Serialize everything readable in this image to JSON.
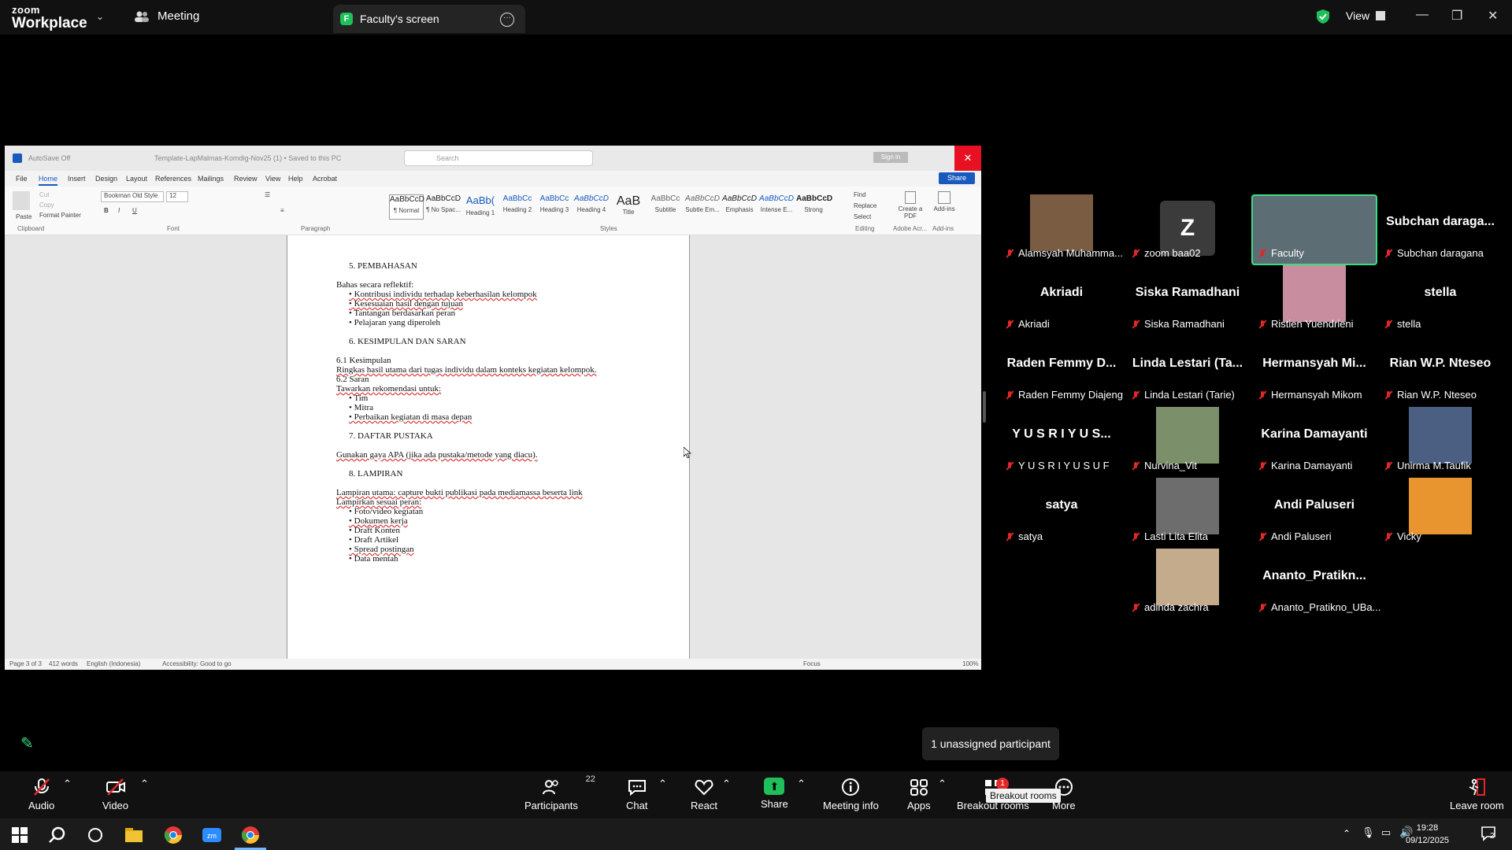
{
  "app": {
    "logo_line1": "zoom",
    "logo_line2": "Workplace"
  },
  "topbar": {
    "meeting_tab": "Meeting",
    "screen_tab": "Faculty's screen",
    "screen_badge": "F",
    "view_label": "View"
  },
  "word": {
    "autosave": "AutoSave  Off",
    "doc_title": "Template-LapMalmas-Komdig-Nov25 (1) • Saved to this PC",
    "search_placeholder": "Search",
    "sign_in": "Sign in",
    "share": "Share",
    "menu": [
      "File",
      "Home",
      "Insert",
      "Design",
      "Layout",
      "References",
      "Mailings",
      "Review",
      "View",
      "Help",
      "Acrobat"
    ],
    "clipboard": {
      "paste": "Paste",
      "cut": "Cut",
      "copy": "Copy",
      "format_painter": "Format Painter"
    },
    "font_name": "Bookman Old Style",
    "font_size": "12",
    "groups": [
      "Clipboard",
      "Font",
      "Paragraph",
      "Styles",
      "Editing",
      "Adobe Acr...",
      "Add-ins"
    ],
    "styles": [
      {
        "sample": "AaBbCcD",
        "name": "¶ Normal"
      },
      {
        "sample": "AaBbCcD",
        "name": "¶ No Spac..."
      },
      {
        "sample": "AaBb(",
        "name": "Heading 1"
      },
      {
        "sample": "AaBbCc",
        "name": "Heading 2"
      },
      {
        "sample": "AaBbCc",
        "name": "Heading 3"
      },
      {
        "sample": "AaBbCcD",
        "name": "Heading 4"
      },
      {
        "sample": "AaB",
        "name": "Title"
      },
      {
        "sample": "AaBbCc",
        "name": "Subtitle"
      },
      {
        "sample": "AaBbCcD",
        "name": "Subtle Em..."
      },
      {
        "sample": "AaBbCcD",
        "name": "Emphasis"
      },
      {
        "sample": "AaBbCcD",
        "name": "Intense E..."
      },
      {
        "sample": "AaBbCcD",
        "name": "Strong"
      }
    ],
    "editing": {
      "find": "Find",
      "replace": "Replace",
      "select": "Select"
    },
    "create_pdf": "Create a PDF",
    "addins": "Add-ins",
    "status": {
      "page": "Page 3 of 3",
      "words": "412 words",
      "language": "English (Indonesia)",
      "accessibility": "Accessibility: Good to go",
      "focus": "Focus",
      "zoom": "100%"
    },
    "doc_lines": [
      "5.   PEMBAHASAN",
      "Bahas secara reflektif:",
      "•   Kontribusi individu terhadap keberhasilan kelompok",
      "•   Kesesuaian hasil dengan tujuan",
      "•   Tantangan berdasarkan peran",
      "•   Pelajaran yang diperoleh",
      "6.   KESIMPULAN DAN SARAN",
      "6.1 Kesimpulan",
      "Ringkas hasil utama dari tugas individu dalam konteks kegiatan kelompok.",
      "6.2 Saran",
      "Tawarkan rekomendasi untuk:",
      "•   Tim",
      "•   Mitra",
      "•   Perbaikan kegiatan di masa depan",
      "7.   DAFTAR PUSTAKA",
      "Gunakan gaya APA (jika ada pustaka/metode yang diacu).",
      "8.   LAMPIRAN",
      "Lampiran utama: capture bukti publikasi pada mediamassa beserta link",
      "Lampirkan sesuai peran:",
      "•   Foto/video kegiatan",
      "•   Dokumen kerja",
      "•   Draft Konten",
      "•   Draft Artikel",
      "•   Spread postingan",
      "•   Data mentah"
    ]
  },
  "participants_gallery": [
    {
      "big": "",
      "label": "Alamsyah Muhamma..."
    },
    {
      "big": "Z",
      "label": "zoom baa02"
    },
    {
      "big": "",
      "label": "Faculty"
    },
    {
      "big": "Subchan daraga...",
      "label": "Subchan daragana"
    },
    {
      "big": "Akriadi",
      "label": "Akriadi"
    },
    {
      "big": "Siska Ramadhani",
      "label": "Siska Ramadhani"
    },
    {
      "big": "",
      "label": "Ristien Yuendrieni"
    },
    {
      "big": "stella",
      "label": "stella"
    },
    {
      "big": "Raden Femmy D...",
      "label": "Raden Femmy Diajeng"
    },
    {
      "big": "Linda Lestari (Ta...",
      "label": "Linda Lestari (Tarie)"
    },
    {
      "big": "Hermansyah Mi...",
      "label": "Hermansyah Mikom"
    },
    {
      "big": "Rian W.P. Nteseo",
      "label": "Rian W.P. Nteseo"
    },
    {
      "big": "Y U S R I  Y U S...",
      "label": "Y U S R I  Y U S U F"
    },
    {
      "big": "",
      "label": "Nurvina_Vit"
    },
    {
      "big": "Karina Damayanti",
      "label": "Karina Damayanti"
    },
    {
      "big": "",
      "label": "Unirma M.Taufik"
    },
    {
      "big": "satya",
      "label": "satya"
    },
    {
      "big": "",
      "label": "Lasti Lita Elita"
    },
    {
      "big": "Andi Paluseri",
      "label": "Andi Paluseri"
    },
    {
      "big": "",
      "label": "Vicky"
    },
    {
      "big": "",
      "label": "adinda zachra"
    },
    {
      "big": "Ananto_Pratikn...",
      "label": "Ananto_Pratikno_UBa..."
    }
  ],
  "unassigned": "1 unassigned participant",
  "toolbar": {
    "audio": "Audio",
    "video": "Video",
    "participants": "Participants",
    "participants_count": "22",
    "chat": "Chat",
    "react": "React",
    "share": "Share",
    "meeting_info": "Meeting info",
    "apps": "Apps",
    "breakout": "Breakout rooms",
    "breakout_tooltip": "Breakout rooms",
    "breakout_badge": "1",
    "more": "More",
    "leave": "Leave room"
  },
  "taskbar": {
    "time": "19:28",
    "date": "09/12/2025",
    "notif_count": "2"
  },
  "colors": {
    "accent_green": "#1fbf5b",
    "mute_red": "#e02828",
    "word_blue": "#185abd"
  }
}
